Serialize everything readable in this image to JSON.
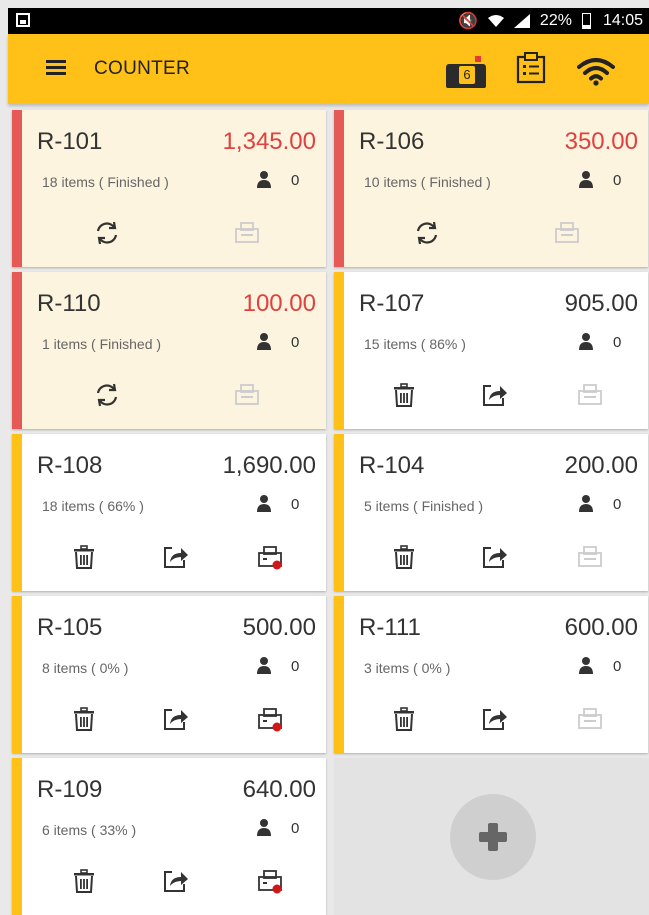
{
  "status_bar": {
    "battery": "22%",
    "time": "14:05"
  },
  "app_bar": {
    "title": "COUNTER",
    "mail_count": "6"
  },
  "orders": [
    {
      "id": "R-101",
      "amount": "1,345.00",
      "items": "18 items ( Finished )",
      "persons": "0",
      "finished": true
    },
    {
      "id": "R-106",
      "amount": "350.00",
      "items": "10 items ( Finished )",
      "persons": "0",
      "finished": true
    },
    {
      "id": "R-110",
      "amount": "100.00",
      "items": "1 items ( Finished )",
      "persons": "0",
      "finished": true
    },
    {
      "id": "R-107",
      "amount": "905.00",
      "items": "15 items ( 86% )",
      "persons": "0",
      "finished": false
    },
    {
      "id": "R-108",
      "amount": "1,690.00",
      "items": "18 items ( 66% )",
      "persons": "0",
      "finished": false
    },
    {
      "id": "R-104",
      "amount": "200.00",
      "items": "5 items ( Finished )",
      "persons": "0",
      "finished": false
    },
    {
      "id": "R-105",
      "amount": "500.00",
      "items": "8 items ( 0% )",
      "persons": "0",
      "finished": false
    },
    {
      "id": "R-111",
      "amount": "600.00",
      "items": "3 items ( 0% )",
      "persons": "0",
      "finished": false
    },
    {
      "id": "R-109",
      "amount": "640.00",
      "items": "6 items ( 33% )",
      "persons": "0",
      "finished": false
    }
  ],
  "colors": {
    "accent": "#ffc117",
    "finished_stripe": "#e55a57",
    "finished_amount": "#e2403e",
    "finished_bg": "#fdf4df"
  }
}
